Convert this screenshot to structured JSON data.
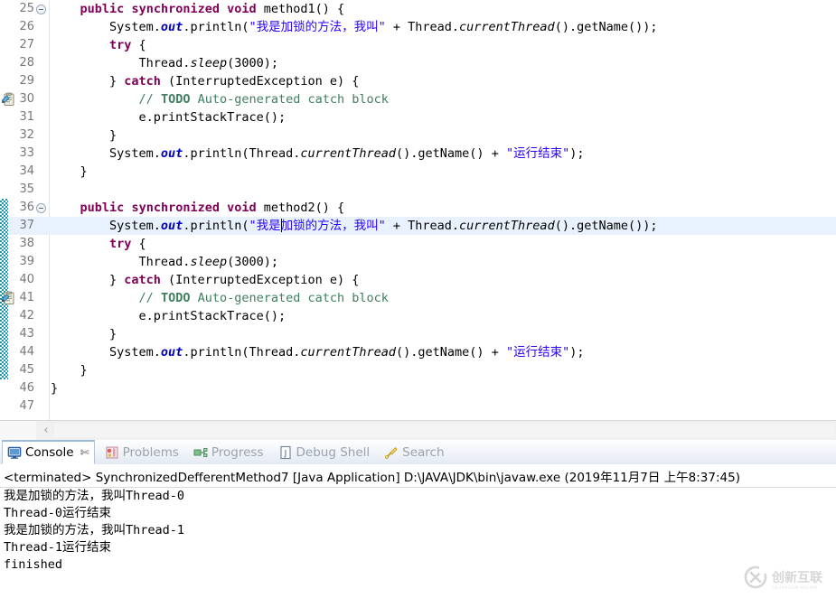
{
  "editor": {
    "first_visible_line_partial": "24",
    "lines": [
      {
        "num": "25",
        "fold": true,
        "marker": "",
        "changed": false,
        "current": false,
        "tokens": [
          {
            "t": "    ",
            "c": ""
          },
          {
            "t": "public",
            "c": "kw"
          },
          {
            "t": " ",
            "c": ""
          },
          {
            "t": "synchronized",
            "c": "kw"
          },
          {
            "t": " ",
            "c": ""
          },
          {
            "t": "void",
            "c": "kw"
          },
          {
            "t": " method1() {",
            "c": ""
          }
        ]
      },
      {
        "num": "26",
        "fold": false,
        "marker": "",
        "changed": false,
        "current": false,
        "tokens": [
          {
            "t": "        System.",
            "c": ""
          },
          {
            "t": "out",
            "c": "fld"
          },
          {
            "t": ".println(",
            "c": ""
          },
          {
            "t": "\"我是加锁的方法，我叫\"",
            "c": "str"
          },
          {
            "t": " + Thread.",
            "c": ""
          },
          {
            "t": "currentThread",
            "c": "mth"
          },
          {
            "t": "().getName());",
            "c": ""
          }
        ]
      },
      {
        "num": "27",
        "fold": false,
        "marker": "",
        "changed": false,
        "current": false,
        "tokens": [
          {
            "t": "        ",
            "c": ""
          },
          {
            "t": "try",
            "c": "kw"
          },
          {
            "t": " {",
            "c": ""
          }
        ]
      },
      {
        "num": "28",
        "fold": false,
        "marker": "",
        "changed": false,
        "current": false,
        "tokens": [
          {
            "t": "            Thread.",
            "c": ""
          },
          {
            "t": "sleep",
            "c": "mth"
          },
          {
            "t": "(3000);",
            "c": ""
          }
        ]
      },
      {
        "num": "29",
        "fold": false,
        "marker": "",
        "changed": false,
        "current": false,
        "tokens": [
          {
            "t": "        } ",
            "c": ""
          },
          {
            "t": "catch",
            "c": "kw"
          },
          {
            "t": " (InterruptedException e) {",
            "c": ""
          }
        ]
      },
      {
        "num": "30",
        "fold": false,
        "marker": "todo-icon",
        "changed": false,
        "current": false,
        "tokens": [
          {
            "t": "            ",
            "c": ""
          },
          {
            "t": "// ",
            "c": "cmt"
          },
          {
            "t": "TODO",
            "c": "todo"
          },
          {
            "t": " Auto-generated catch block",
            "c": "cmt"
          }
        ]
      },
      {
        "num": "31",
        "fold": false,
        "marker": "",
        "changed": false,
        "current": false,
        "tokens": [
          {
            "t": "            e.printStackTrace();",
            "c": ""
          }
        ]
      },
      {
        "num": "32",
        "fold": false,
        "marker": "",
        "changed": false,
        "current": false,
        "tokens": [
          {
            "t": "        }",
            "c": ""
          }
        ]
      },
      {
        "num": "33",
        "fold": false,
        "marker": "",
        "changed": false,
        "current": false,
        "tokens": [
          {
            "t": "        System.",
            "c": ""
          },
          {
            "t": "out",
            "c": "fld"
          },
          {
            "t": ".println(Thread.",
            "c": ""
          },
          {
            "t": "currentThread",
            "c": "mth"
          },
          {
            "t": "().getName() + ",
            "c": ""
          },
          {
            "t": "\"运行结束\"",
            "c": "str"
          },
          {
            "t": ");",
            "c": ""
          }
        ]
      },
      {
        "num": "34",
        "fold": false,
        "marker": "",
        "changed": false,
        "current": false,
        "tokens": [
          {
            "t": "    }",
            "c": ""
          }
        ]
      },
      {
        "num": "35",
        "fold": false,
        "marker": "",
        "changed": false,
        "current": false,
        "tokens": [
          {
            "t": "",
            "c": ""
          }
        ]
      },
      {
        "num": "36",
        "fold": true,
        "marker": "",
        "changed": true,
        "current": false,
        "tokens": [
          {
            "t": "    ",
            "c": ""
          },
          {
            "t": "public",
            "c": "kw"
          },
          {
            "t": " ",
            "c": ""
          },
          {
            "t": "synchronized",
            "c": "kw"
          },
          {
            "t": " ",
            "c": ""
          },
          {
            "t": "void",
            "c": "kw"
          },
          {
            "t": " method2() {",
            "c": ""
          }
        ]
      },
      {
        "num": "37",
        "fold": false,
        "marker": "",
        "changed": true,
        "current": true,
        "caret_after": 4,
        "tokens": [
          {
            "t": "        System.",
            "c": ""
          },
          {
            "t": "out",
            "c": "fld"
          },
          {
            "t": ".println(",
            "c": ""
          },
          {
            "t": "\"我是",
            "c": "str"
          },
          {
            "t": "加锁的方法，我叫\"",
            "c": "str"
          },
          {
            "t": " + Thread.",
            "c": ""
          },
          {
            "t": "currentThread",
            "c": "mth"
          },
          {
            "t": "().getName());",
            "c": ""
          }
        ]
      },
      {
        "num": "38",
        "fold": false,
        "marker": "",
        "changed": true,
        "current": false,
        "tokens": [
          {
            "t": "        ",
            "c": ""
          },
          {
            "t": "try",
            "c": "kw"
          },
          {
            "t": " {",
            "c": ""
          }
        ]
      },
      {
        "num": "39",
        "fold": false,
        "marker": "",
        "changed": true,
        "current": false,
        "tokens": [
          {
            "t": "            Thread.",
            "c": ""
          },
          {
            "t": "sleep",
            "c": "mth"
          },
          {
            "t": "(3000);",
            "c": ""
          }
        ]
      },
      {
        "num": "40",
        "fold": false,
        "marker": "",
        "changed": true,
        "current": false,
        "tokens": [
          {
            "t": "        } ",
            "c": ""
          },
          {
            "t": "catch",
            "c": "kw"
          },
          {
            "t": " (InterruptedException e) {",
            "c": ""
          }
        ]
      },
      {
        "num": "41",
        "fold": false,
        "marker": "todo-icon",
        "changed": true,
        "current": false,
        "tokens": [
          {
            "t": "            ",
            "c": ""
          },
          {
            "t": "// ",
            "c": "cmt"
          },
          {
            "t": "TODO",
            "c": "todo"
          },
          {
            "t": " Auto-generated catch block",
            "c": "cmt"
          }
        ]
      },
      {
        "num": "42",
        "fold": false,
        "marker": "",
        "changed": true,
        "current": false,
        "tokens": [
          {
            "t": "            e.printStackTrace();",
            "c": ""
          }
        ]
      },
      {
        "num": "43",
        "fold": false,
        "marker": "",
        "changed": true,
        "current": false,
        "tokens": [
          {
            "t": "        }",
            "c": ""
          }
        ]
      },
      {
        "num": "44",
        "fold": false,
        "marker": "",
        "changed": true,
        "current": false,
        "tokens": [
          {
            "t": "        System.",
            "c": ""
          },
          {
            "t": "out",
            "c": "fld"
          },
          {
            "t": ".println(Thread.",
            "c": ""
          },
          {
            "t": "currentThread",
            "c": "mth"
          },
          {
            "t": "().getName() + ",
            "c": ""
          },
          {
            "t": "\"运行结束\"",
            "c": "str"
          },
          {
            "t": ");",
            "c": ""
          }
        ]
      },
      {
        "num": "45",
        "fold": false,
        "marker": "",
        "changed": true,
        "current": false,
        "tokens": [
          {
            "t": "    }",
            "c": ""
          }
        ]
      },
      {
        "num": "46",
        "fold": false,
        "marker": "",
        "changed": false,
        "current": false,
        "tokens": [
          {
            "t": "}",
            "c": ""
          }
        ]
      },
      {
        "num": "47",
        "fold": false,
        "marker": "",
        "changed": false,
        "current": false,
        "tokens": [
          {
            "t": "",
            "c": ""
          }
        ]
      }
    ],
    "hscrollbar": {
      "left_arrow": "‹"
    }
  },
  "console_panel": {
    "tabs": [
      {
        "label": "Console",
        "icon": "console-icon",
        "active": true,
        "closable": true,
        "close_glyph": "✄"
      },
      {
        "label": "Problems",
        "icon": "problems-icon",
        "active": false,
        "closable": false,
        "close_glyph": ""
      },
      {
        "label": "Progress",
        "icon": "progress-icon",
        "active": false,
        "closable": false,
        "close_glyph": ""
      },
      {
        "label": "Debug Shell",
        "icon": "debug-shell-icon",
        "active": false,
        "closable": false,
        "close_glyph": ""
      },
      {
        "label": "Search",
        "icon": "search-icon",
        "active": false,
        "closable": false,
        "close_glyph": ""
      }
    ],
    "header": "<terminated> SynchronizedDefferentMethod7 [Java Application] D:\\JAVA\\JDK\\bin\\javaw.exe (2019年11月7日 上午8:37:45)",
    "output": [
      "我是加锁的方法，我叫Thread-0",
      "Thread-0运行结束",
      "我是加锁的方法，我叫Thread-1",
      "Thread-1运行结束",
      "finished"
    ]
  },
  "watermark": {
    "text": "创新互联",
    "subtext": "CHUANGXIN  HULIAN",
    "logo": "cx-logo-icon"
  },
  "colors": {
    "keyword": "#7F0055",
    "string": "#2A00FF",
    "comment": "#3F7F5F",
    "field": "#0000C0",
    "current_line": "#E8F2FE",
    "change_bar": "#1A93AD",
    "gutter_text": "#787878"
  }
}
